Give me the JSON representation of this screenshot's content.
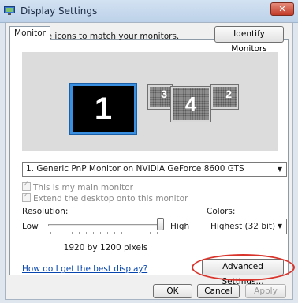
{
  "window": {
    "title": "Display Settings",
    "close_label": "✕"
  },
  "tabs": [
    {
      "label": "Monitor",
      "selected": true
    }
  ],
  "monitor_tab": {
    "drag_text": "Drag the icons to match your monitors.",
    "identify_button": "Identify Monitors",
    "monitors": [
      {
        "number": "1",
        "selected": true
      },
      {
        "number": "3",
        "selected": false
      },
      {
        "number": "4",
        "selected": false
      },
      {
        "number": "2",
        "selected": false
      }
    ],
    "monitor_select": {
      "value": "1. Generic PnP Monitor on NVIDIA GeForce 8600 GTS"
    },
    "main_monitor_check": {
      "label": "This is my main monitor",
      "checked": true,
      "enabled": false
    },
    "extend_desktop_check": {
      "label": "Extend the desktop onto this monitor",
      "checked": true,
      "enabled": false
    },
    "resolution": {
      "label": "Resolution:",
      "low_label": "Low",
      "high_label": "High",
      "slider_value": 1.0,
      "value_text": "1920 by 1200 pixels"
    },
    "colors": {
      "label": "Colors:",
      "value": "Highest (32 bit)"
    },
    "help_link": "How do I get the best display?",
    "advanced_button": "Advanced Settings..."
  },
  "dialog_buttons": {
    "ok": "OK",
    "cancel": "Cancel",
    "apply": "Apply"
  },
  "colors_theme": {
    "accent": "#3b8fe0",
    "highlight_circle": "#d9342b",
    "link": "#0645ad"
  }
}
